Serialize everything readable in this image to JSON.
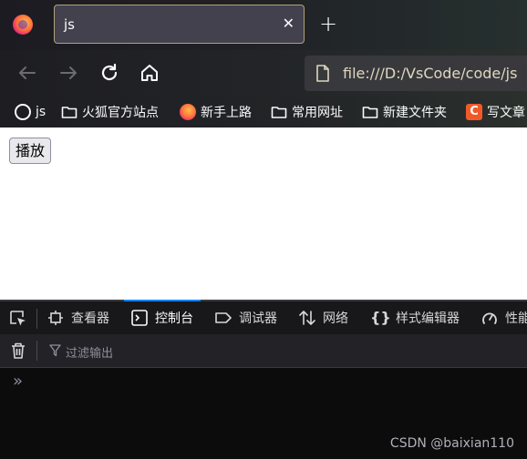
{
  "tab": {
    "title": "js",
    "close_symbol": "✕"
  },
  "new_tab_symbol": "+",
  "urlbar": {
    "url": "file:///D:/VsCode/code/js"
  },
  "bookmarks": [
    {
      "label": "js",
      "icon": "globe-icon"
    },
    {
      "label": "火狐官方站点",
      "icon": "folder-icon"
    },
    {
      "label": "新手上路",
      "icon": "firefox-icon"
    },
    {
      "label": "常用网址",
      "icon": "folder-icon"
    },
    {
      "label": "新建文件夹",
      "icon": "folder-icon"
    },
    {
      "label": "写文章",
      "icon": "csdn-icon",
      "icon_text": "C"
    }
  ],
  "page": {
    "play_button": "播放"
  },
  "devtools": {
    "tabs": [
      {
        "label": "查看器",
        "icon": "inspector-icon"
      },
      {
        "label": "控制台",
        "icon": "console-icon",
        "active": true
      },
      {
        "label": "调试器",
        "icon": "debugger-icon"
      },
      {
        "label": "网络",
        "icon": "network-icon"
      },
      {
        "label": "样式编辑器",
        "icon": "style-editor-icon"
      },
      {
        "label": "性能",
        "icon": "performance-icon"
      }
    ],
    "filter_placeholder": "过滤输出",
    "prompt": "»"
  },
  "watermark": "CSDN @baixian110",
  "colors": {
    "active_tab_accent": "#0a84ff",
    "csdn": "#f05a28"
  }
}
